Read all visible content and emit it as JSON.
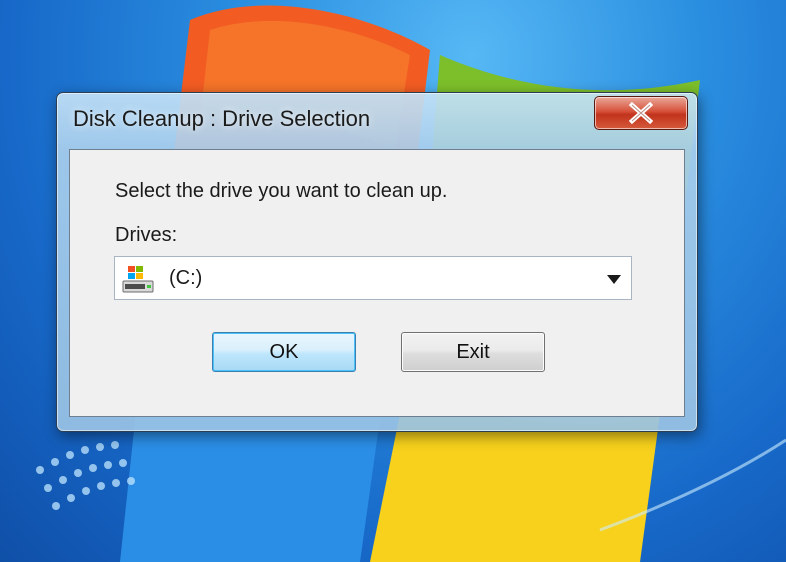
{
  "window": {
    "title": "Disk Cleanup : Drive Selection",
    "close_icon": "close-x-icon"
  },
  "dialog": {
    "prompt": "Select the drive you want to clean up.",
    "drives_label": "Drives:",
    "drive_select": {
      "selected_value": "(C:)",
      "icon": "windows-drive-icon",
      "dropdown_icon": "chevron-down-icon"
    },
    "ok_label": "OK",
    "exit_label": "Exit"
  },
  "colors": {
    "desktop_blue": "#1b6fc9",
    "close_red": "#c1331c",
    "ok_focus_border": "#3c7fb1"
  }
}
